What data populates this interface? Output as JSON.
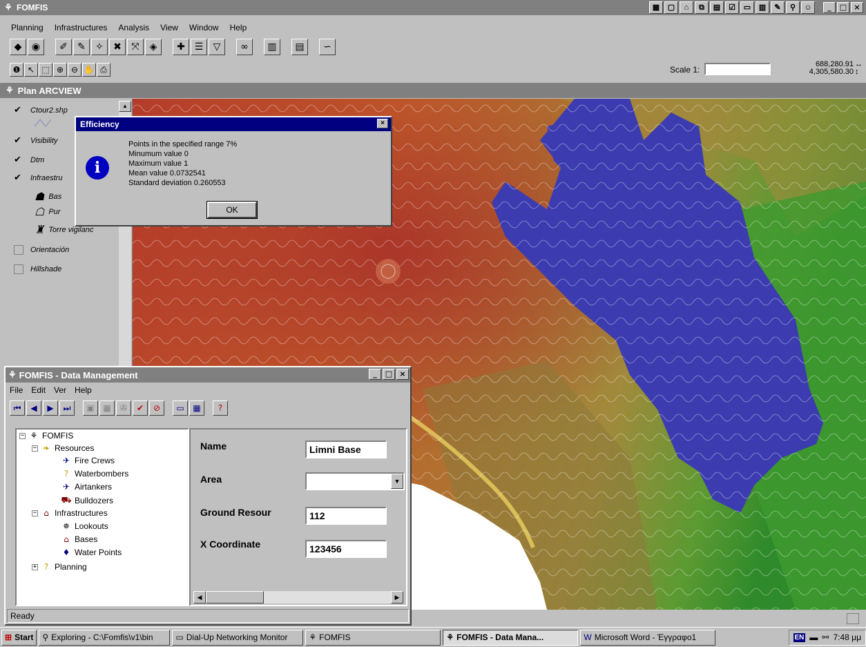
{
  "app": {
    "title": "FOMFIS"
  },
  "menu": [
    "Planning",
    "Infrastructures",
    "Analysis",
    "View",
    "Window",
    "Help"
  ],
  "scale": {
    "label": "Scale 1:",
    "value": ""
  },
  "coords": {
    "x": "688,280.91",
    "y": "4,305,580.30"
  },
  "plan": {
    "title": "Plan ARCVIEW"
  },
  "legend": {
    "items": [
      {
        "label": "Ctour2.shp",
        "checked": true
      },
      {
        "label": "Visibility",
        "checked": true
      },
      {
        "label": "Dtm",
        "checked": true
      },
      {
        "label": "Infraestru",
        "checked": true
      },
      {
        "label": "Bas"
      },
      {
        "label": "Pur"
      },
      {
        "label": "Torre vigilanc"
      },
      {
        "label": "Orientación",
        "checked": false
      },
      {
        "label": "Hillshade",
        "checked": false
      }
    ]
  },
  "dialog": {
    "title": "Efficiency",
    "lines": [
      "Points in the specified range 7%",
      "Minumum value 0",
      "Maximum value 1",
      "Mean value 0.0732541",
      "Standard deviation 0.260553"
    ],
    "ok": "OK"
  },
  "dm": {
    "title": "FOMFIS - Data Management",
    "menu": [
      "File",
      "Edit",
      "Ver",
      "Help"
    ],
    "tree": [
      {
        "label": "FOMFIS"
      },
      {
        "label": "Resources"
      },
      {
        "label": "Fire Crews"
      },
      {
        "label": "Waterbombers"
      },
      {
        "label": "Airtankers"
      },
      {
        "label": "Bulldozers"
      },
      {
        "label": "Infrastructures"
      },
      {
        "label": "Lookouts"
      },
      {
        "label": "Bases"
      },
      {
        "label": "Water Points"
      },
      {
        "label": "Planning"
      }
    ],
    "form": {
      "name_label": "Name",
      "name_value": "Limni Base",
      "area_label": "Area",
      "area_value": "",
      "ground_label": "Ground Resour",
      "ground_value": "112",
      "x_label": "X Coordinate",
      "x_value": "123456"
    },
    "status": "Ready"
  },
  "taskbar": {
    "start": "Start",
    "tasks": [
      "Exploring - C:\\Fomfis\\v1\\bin",
      "Dial-Up Networking Monitor",
      "FOMFIS",
      "FOMFIS - Data Mana...",
      "Microsoft Word - Έγγραφο1"
    ],
    "lang": "EN",
    "clock": "7:48 μμ"
  }
}
